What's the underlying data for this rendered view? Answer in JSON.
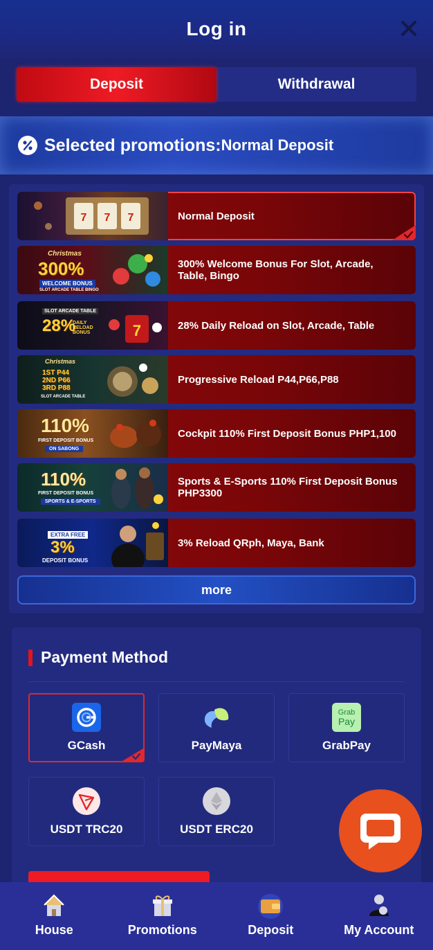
{
  "header": {
    "title": "Log in"
  },
  "tabs": [
    {
      "label": "Deposit",
      "active": true
    },
    {
      "label": "Withdrawal",
      "active": false
    }
  ],
  "selected_promotion": {
    "label": "Selected promotions:",
    "value": "Normal Deposit"
  },
  "promotions": [
    {
      "label": "Normal Deposit",
      "selected": true
    },
    {
      "label": "300% Welcome Bonus For Slot, Arcade, Table, Bingo",
      "thumb_big": "300%",
      "thumb_top": "Christmas",
      "thumb_sub": "WELCOME BONUS",
      "thumb_foot": "SLOT ARCADE TABLE BINGO"
    },
    {
      "label": "28% Daily Reload on Slot, Arcade, Table",
      "thumb_big": "28%",
      "thumb_top": "SLOT ARCADE TABLE",
      "thumb_sub": "DAILY RELOAD BONUS"
    },
    {
      "label": "Progressive Reload P44,P66,P88",
      "thumb_top": "Christmas",
      "thumb_lines": [
        "1ST P44",
        "2ND P66",
        "3RD P88"
      ],
      "thumb_foot": "SLOT ARCADE TABLE"
    },
    {
      "label": "Cockpit 110% First Deposit Bonus PHP1,100",
      "thumb_big": "110%",
      "thumb_sub": "FIRST DEPOSIT BONUS",
      "thumb_foot": "ON SABONG"
    },
    {
      "label": "Sports & E-Sports 110% First Deposit Bonus PHP3300",
      "thumb_big": "110%",
      "thumb_sub": "FIRST DEPOSIT BONUS",
      "thumb_foot": "SPORTS & E-SPORTS"
    },
    {
      "label": "3% Reload QRph, Maya, Bank",
      "thumb_big": "3%",
      "thumb_top": "EXTRA FREE",
      "thumb_foot": "DEPOSIT BONUS"
    }
  ],
  "more_label": "more",
  "payment": {
    "title": "Payment Method",
    "methods": [
      {
        "name": "GCash",
        "icon": "gcash-icon",
        "selected": true
      },
      {
        "name": "PayMaya",
        "icon": "paymaya-icon"
      },
      {
        "name": "GrabPay",
        "icon": "grabpay-icon",
        "icon_text": [
          "Grab",
          "Pay"
        ]
      },
      {
        "name": "USDT TRC20",
        "icon": "tron-icon"
      },
      {
        "name": "USDT ERC20",
        "icon": "ethereum-icon"
      }
    ]
  },
  "bottom_nav": [
    {
      "label": "House",
      "icon": "house-icon"
    },
    {
      "label": "Promotions",
      "icon": "gift-icon"
    },
    {
      "label": "Deposit",
      "icon": "wallet-icon",
      "active": true
    },
    {
      "label": "My Account",
      "icon": "account-icon"
    }
  ],
  "colors": {
    "accent_red": "#ee1b24",
    "bg_navy": "#1d2470",
    "chat_orange": "#e8501e"
  }
}
